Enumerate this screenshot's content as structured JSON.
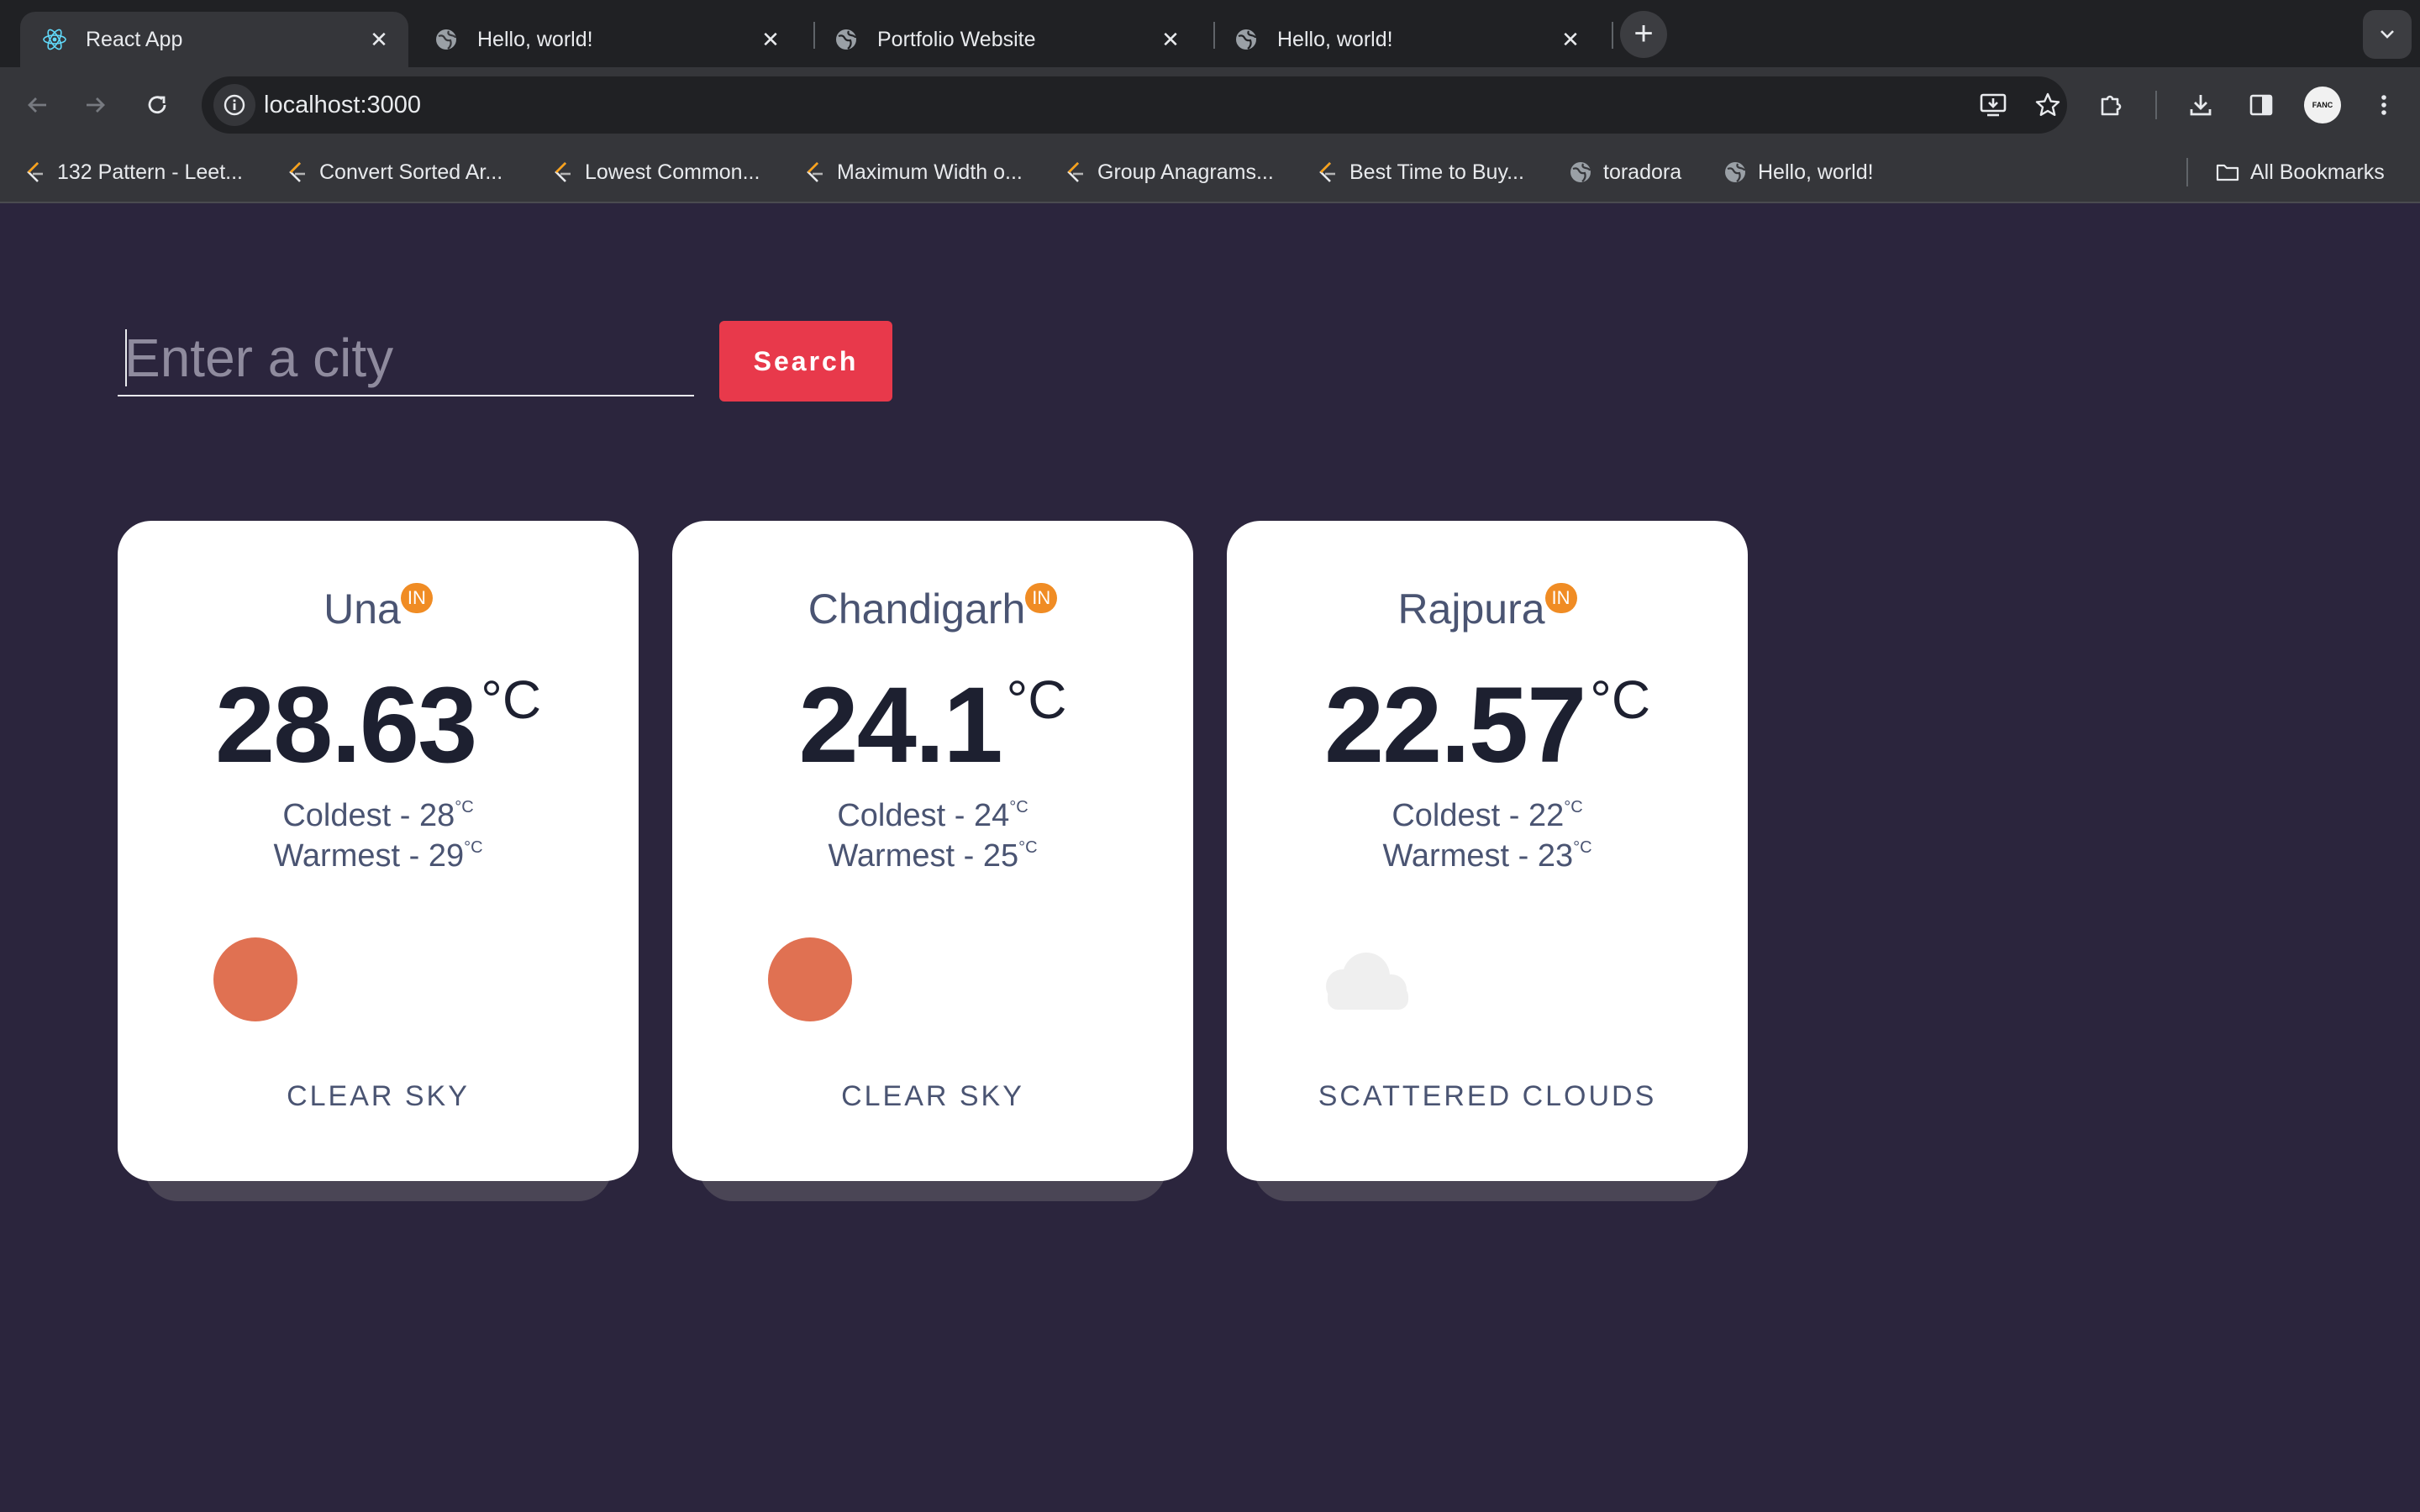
{
  "browser": {
    "tabs": [
      {
        "title": "React App",
        "icon": "react-icon",
        "active": true
      },
      {
        "title": "Hello, world!",
        "icon": "globe-icon",
        "active": false
      },
      {
        "title": "Portfolio Website",
        "icon": "globe-icon",
        "active": false
      },
      {
        "title": "Hello, world!",
        "icon": "globe-icon",
        "active": false
      }
    ],
    "close_glyph": "✕",
    "new_tab_glyph": "+",
    "url": "localhost:3000",
    "avatar_text": "FANC",
    "bookmarks": [
      {
        "label": "132 Pattern - Leet...",
        "icon": "leetcode-icon"
      },
      {
        "label": "Convert Sorted Ar...",
        "icon": "leetcode-icon"
      },
      {
        "label": "Lowest Common...",
        "icon": "leetcode-icon"
      },
      {
        "label": "Maximum Width o...",
        "icon": "leetcode-icon"
      },
      {
        "label": "Group Anagrams...",
        "icon": "leetcode-icon"
      },
      {
        "label": "Best Time to Buy...",
        "icon": "leetcode-icon"
      },
      {
        "label": "toradora",
        "icon": "globe-icon"
      },
      {
        "label": "Hello, world!",
        "icon": "globe-icon"
      }
    ],
    "all_bookmarks_label": "All Bookmarks"
  },
  "app": {
    "search": {
      "placeholder": "Enter a city",
      "button_label": "Search"
    },
    "cards": [
      {
        "city": "Una",
        "country": "IN",
        "temp": "28.63",
        "unit": "°C",
        "coldest_label": "Coldest - 28",
        "warmest_label": "Warmest - 29",
        "mini_unit": "°C",
        "icon": "sun-icon",
        "description": "CLEAR SKY"
      },
      {
        "city": "Chandigarh",
        "country": "IN",
        "temp": "24.1",
        "unit": "°C",
        "coldest_label": "Coldest - 24",
        "warmest_label": "Warmest - 25",
        "mini_unit": "°C",
        "icon": "sun-icon",
        "description": "CLEAR SKY"
      },
      {
        "city": "Rajpura",
        "country": "IN",
        "temp": "22.57",
        "unit": "°C",
        "coldest_label": "Coldest - 22",
        "warmest_label": "Warmest - 23",
        "mini_unit": "°C",
        "icon": "cloud-icon",
        "description": "SCATTERED CLOUDS"
      }
    ]
  },
  "colors": {
    "page_background": "#2b253d",
    "search_button": "#e8394b",
    "country_badge": "#f08c24",
    "sun": "#e07152"
  }
}
